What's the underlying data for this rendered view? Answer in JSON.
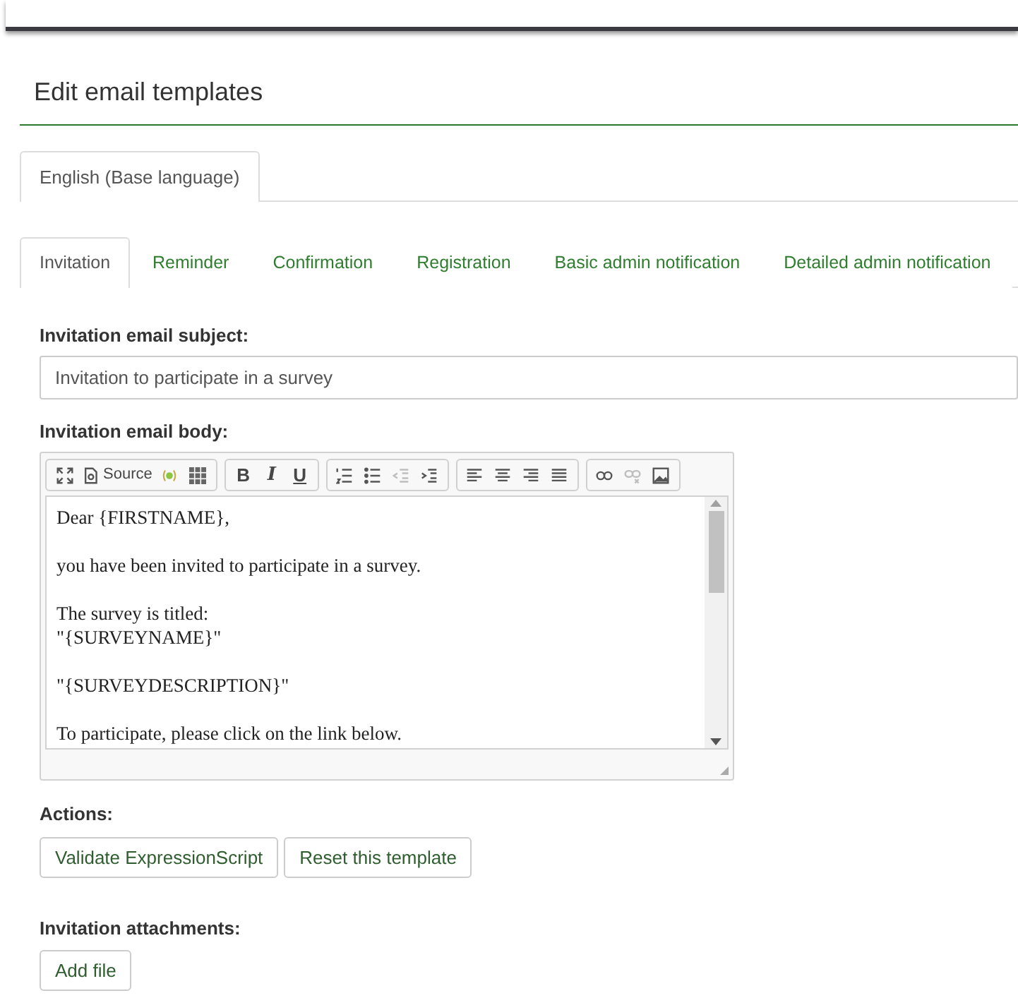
{
  "page_title": "Edit email templates",
  "language_tabs": [
    {
      "label": "English (Base language)",
      "selected": true
    }
  ],
  "template_tabs": [
    {
      "label": "Invitation",
      "selected": true
    },
    {
      "label": "Reminder",
      "selected": false
    },
    {
      "label": "Confirmation",
      "selected": false
    },
    {
      "label": "Registration",
      "selected": false
    },
    {
      "label": "Basic admin notification",
      "selected": false
    },
    {
      "label": "Detailed admin notification",
      "selected": false
    }
  ],
  "subject": {
    "label": "Invitation email subject:",
    "value": "Invitation to participate in a survey"
  },
  "body": {
    "label": "Invitation email body:",
    "toolbar": [
      [
        {
          "kind": "maximize",
          "disabled": false
        },
        {
          "kind": "source",
          "label": "Source",
          "disabled": false
        },
        {
          "kind": "placeholder",
          "disabled": false
        },
        {
          "kind": "table",
          "disabled": false
        }
      ],
      [
        {
          "kind": "bold",
          "label": "B",
          "disabled": false
        },
        {
          "kind": "italic",
          "label": "I",
          "disabled": false
        },
        {
          "kind": "underline",
          "label": "U",
          "disabled": false
        }
      ],
      [
        {
          "kind": "ordered-list",
          "disabled": false
        },
        {
          "kind": "bulleted-list",
          "disabled": false
        },
        {
          "kind": "outdent",
          "disabled": true
        },
        {
          "kind": "indent",
          "disabled": false
        }
      ],
      [
        {
          "kind": "align-left",
          "disabled": false
        },
        {
          "kind": "align-center",
          "disabled": false
        },
        {
          "kind": "align-right",
          "disabled": false
        },
        {
          "kind": "justify",
          "disabled": false
        }
      ],
      [
        {
          "kind": "link",
          "disabled": false
        },
        {
          "kind": "unlink",
          "disabled": true
        },
        {
          "kind": "image",
          "disabled": false
        }
      ]
    ],
    "paragraphs": [
      [
        "Dear {FIRSTNAME},"
      ],
      [
        "you have been invited to participate in a survey."
      ],
      [
        "The survey is titled:",
        "\"{SURVEYNAME}\""
      ],
      [
        "\"{SURVEYDESCRIPTION}\""
      ],
      [
        "To participate, please click on the link below."
      ]
    ]
  },
  "actions": {
    "label": "Actions:",
    "buttons": [
      "Validate ExpressionScript",
      "Reset this template"
    ]
  },
  "attachments": {
    "label": "Invitation attachments:",
    "buttons": [
      "Add file"
    ]
  }
}
